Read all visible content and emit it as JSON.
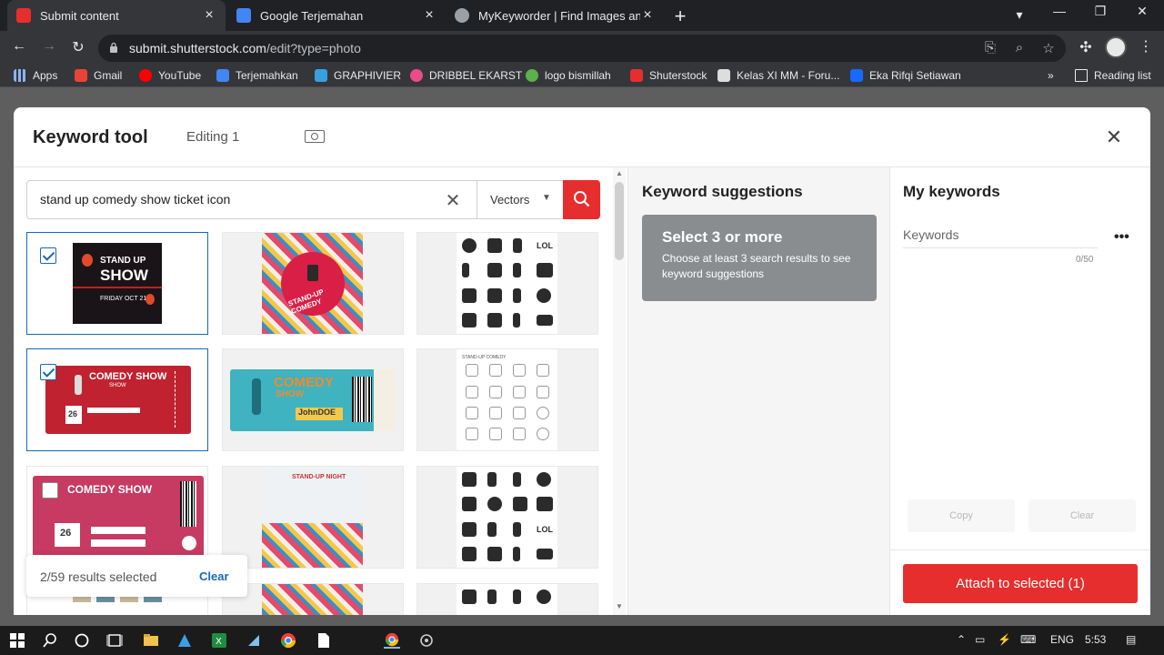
{
  "browser": {
    "tabs": [
      {
        "title": "Submit content",
        "active": true
      },
      {
        "title": "Google Terjemahan",
        "active": false
      },
      {
        "title": "MyKeyworder | Find Images and",
        "active": false
      }
    ],
    "url_host": "submit.shutterstock.com",
    "url_path": "/edit?type=photo",
    "bookmarks": [
      "Apps",
      "Gmail",
      "YouTube",
      "Terjemahkan",
      "GRAPHIVIER",
      "DRIBBEL EKARST",
      "logo bismillah",
      "Shuterstock",
      "Kelas XI MM - Foru...",
      "Eka Rifqi Setiawan"
    ],
    "reading_list": "Reading list",
    "overflow": "»"
  },
  "modal": {
    "title": "Keyword tool",
    "editing": "Editing 1",
    "close": "✕"
  },
  "search": {
    "query": "stand up comedy show ticket icon",
    "type": "Vectors"
  },
  "grid": {
    "thumbs": {
      "standup_l1": "STAND UP",
      "standup_l2": "SHOW",
      "standup_date": "FRIDAY OCT 21",
      "pattern_label": "STAND-UP COMEDY",
      "icons_lol": "LOL",
      "outline_head": "STAND-UP COMEDY",
      "red_title": "COMEDY SHOW",
      "red_sub": "SHOW",
      "red_date": "26",
      "teal_title": "COMEDY",
      "teal_sub": "SHOW",
      "teal_name": "JohnDOE",
      "pink_title": "COMEDY SHOW",
      "pink_date": "26",
      "night_title": "STAND-UP NIGHT"
    }
  },
  "results": {
    "count": "2/59 results selected",
    "clear": "Clear"
  },
  "suggestions": {
    "heading": "Keyword suggestions",
    "card_title": "Select 3 or more",
    "card_text": "Choose at least 3 search results to see keyword suggestions"
  },
  "my_keywords": {
    "heading": "My keywords",
    "placeholder": "Keywords",
    "count": "0/50",
    "menu": "•••",
    "copy": "Copy",
    "clear": "Clear",
    "attach": "Attach to selected (1)"
  },
  "taskbar": {
    "lang": "ENG",
    "time": "5:53"
  },
  "colors": {
    "accent_red": "#e62e2e",
    "select_blue": "#1569b8",
    "card_gray": "#8a8d90"
  }
}
